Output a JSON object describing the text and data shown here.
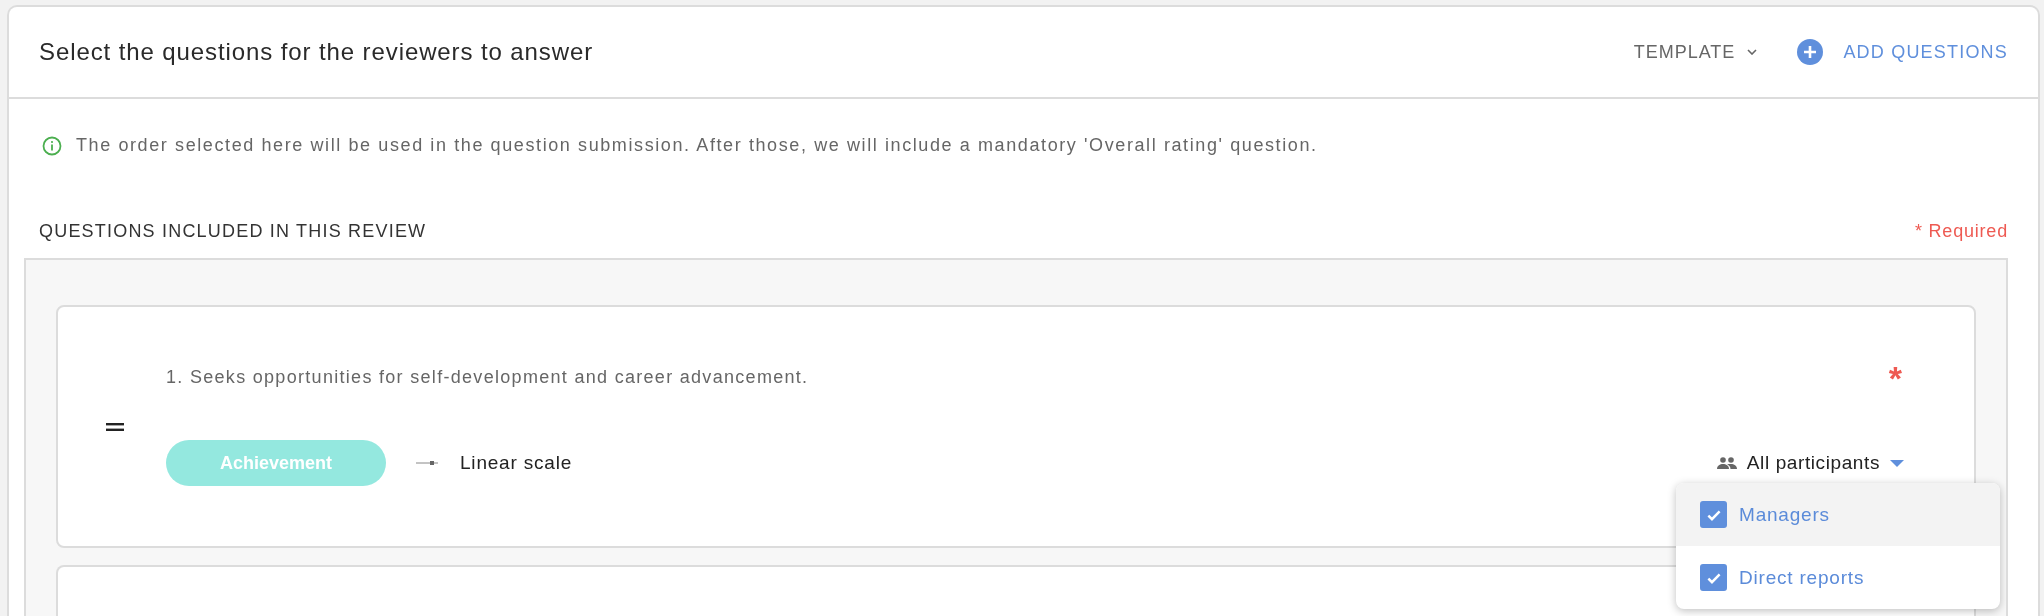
{
  "header": {
    "title": "Select the questions for the reviewers to answer",
    "template_button": "TEMPLATE",
    "add_button": "ADD QUESTIONS"
  },
  "info": "The order selected here will be used in the question submission. After those, we will include a mandatory 'Overall rating' question.",
  "section": {
    "title": "QUESTIONS INCLUDED IN THIS REVIEW",
    "required_note": "* Required"
  },
  "questions": [
    {
      "text": "1. Seeks opportunities for self-development and career advancement.",
      "required": true,
      "required_mark": "*",
      "category": "Achievement",
      "answer_type": "Linear scale",
      "audience": "All participants",
      "audience_menu": [
        {
          "label": "Managers",
          "checked": true,
          "highlighted": true
        },
        {
          "label": "Direct reports",
          "checked": true,
          "highlighted": false
        }
      ]
    },
    {
      "kind": "cut_off"
    }
  ]
}
